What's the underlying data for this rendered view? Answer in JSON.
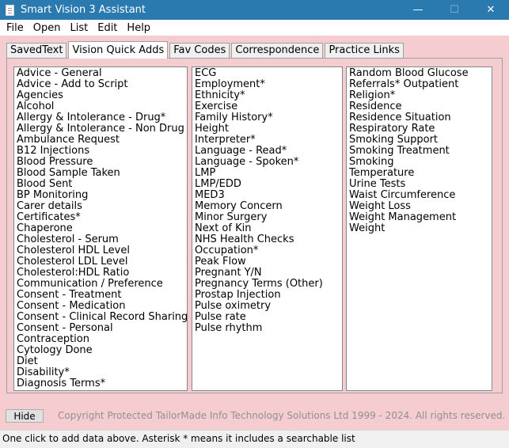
{
  "window": {
    "title": "Smart Vision 3 Assistant",
    "controls": {
      "minimize": "—",
      "maximize": "☐",
      "close": "✕"
    }
  },
  "menu": [
    "File",
    "Open",
    "List",
    "Edit",
    "Help"
  ],
  "tabs": [
    {
      "label": "SavedText",
      "active": false
    },
    {
      "label": "Vision Quick Adds",
      "active": true
    },
    {
      "label": "Fav Codes",
      "active": false
    },
    {
      "label": "Correspondence",
      "active": false
    },
    {
      "label": "Practice Links",
      "active": false
    }
  ],
  "lists": {
    "column1": [
      "Advice - General",
      "Advice - Add to Script",
      "Agencies",
      "Alcohol",
      "Allergy & Intolerance - Drug*",
      "Allergy & Intolerance - Non Drug",
      "Ambulance Request",
      "B12 Injections",
      "Blood Pressure",
      "Blood Sample Taken",
      "Blood Sent",
      "BP Monitoring",
      "Carer details",
      "Certificates*",
      "Chaperone",
      "Cholesterol - Serum",
      "Cholesterol HDL Level",
      "Cholesterol LDL Level",
      "Cholesterol:HDL Ratio",
      "Communication / Preference",
      "Consent - Treatment",
      "Consent - Medication",
      "Consent - Clinical Record Sharing",
      "Consent - Personal",
      "Contraception",
      "Cytology Done",
      "Diet",
      "Disability*",
      "Diagnosis Terms*"
    ],
    "column2": [
      "ECG",
      "Employment*",
      "Ethnicity*",
      "Exercise",
      "Family History*",
      "Height",
      "Interpreter*",
      "Language - Read*",
      "Language - Spoken*",
      "LMP",
      "LMP/EDD",
      "MED3",
      "Memory Concern",
      "Minor Surgery",
      "Next of Kin",
      "NHS Health Checks",
      "Occupation*",
      "Peak Flow",
      "Pregnant Y/N",
      "Pregnancy Terms (Other)",
      "Prostap Injection",
      "Pulse oximetry",
      "Pulse rate",
      "Pulse rhythm"
    ],
    "column3": [
      "Random Blood Glucose",
      "Referrals* Outpatient",
      "Religion*",
      "Residence",
      "Residence Situation",
      "Respiratory Rate",
      "Smoking Support",
      "Smoking Treatment",
      "Smoking",
      "Temperature",
      "Urine Tests",
      "Waist Circumference",
      "Weight Loss",
      "Weight Management",
      "Weight"
    ]
  },
  "footer": {
    "hide_label": "Hide",
    "copyright": "Copyright Protected TailorMade Info Technology Solutions Ltd 1999 - 2024. All rights reserved."
  },
  "status": "One click to add data above. Asterisk * means it includes a searchable list"
}
